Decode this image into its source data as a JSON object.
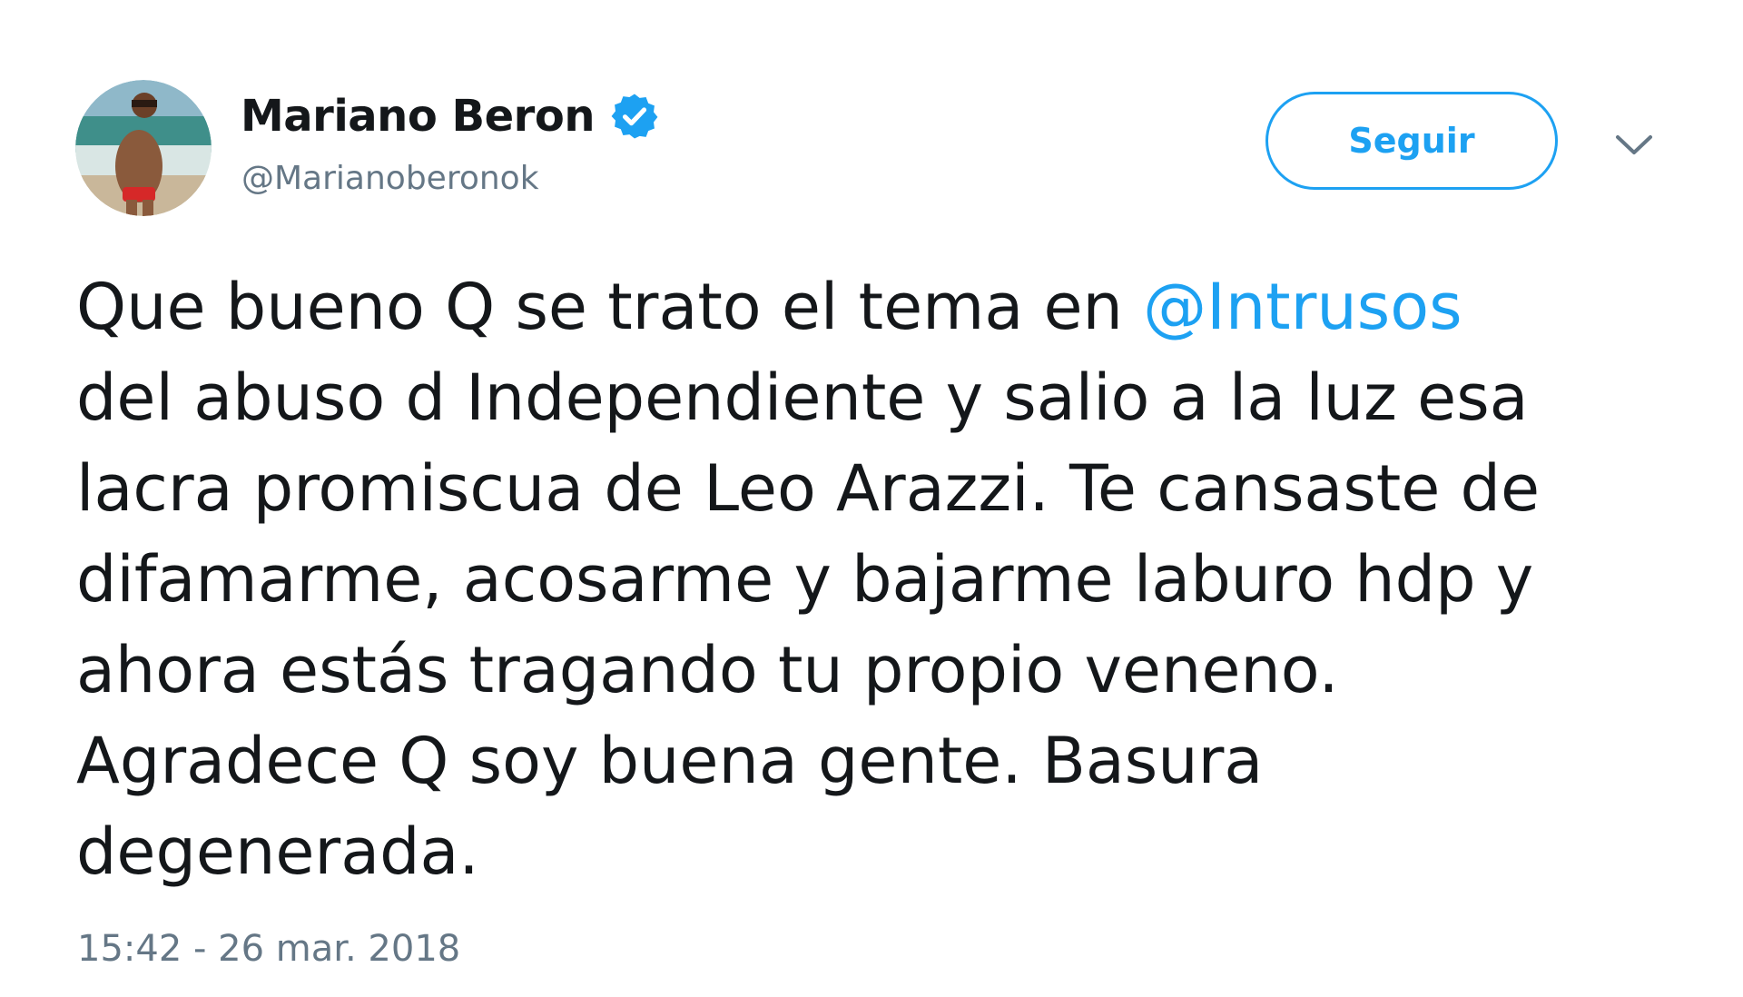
{
  "user": {
    "display_name": "Mariano Beron",
    "handle": "@Marianoberonok",
    "verified": true
  },
  "actions": {
    "follow_label": "Seguir",
    "menu_icon": "chevron-down-icon"
  },
  "tweet": {
    "line1_before": "Que bueno Q se trato el tema en ",
    "line1_mention": "@Intrusos",
    "line2": "del abuso d Independiente y salio a la luz esa",
    "line3": "lacra promiscua de Leo Arazzi. Te cansaste de",
    "line4": "difamarme, acosarme y bajarme laburo hdp y",
    "line5": "ahora estás tragando tu propio veneno.",
    "line6": "Agradece Q soy buena gente. Basura",
    "line7": "degenerada.",
    "timestamp": "15:42 - 26 mar. 2018"
  },
  "colors": {
    "accent": "#1da1f2",
    "text": "#14171a",
    "secondary": "#657786"
  }
}
